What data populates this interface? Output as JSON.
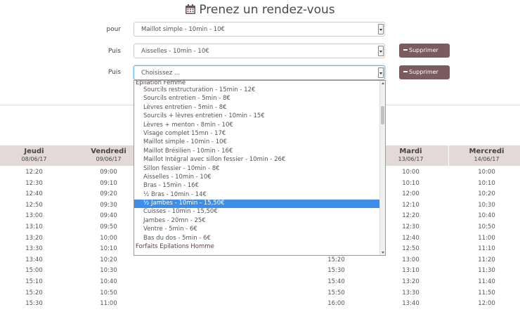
{
  "title": "Prenez un rendez-vous",
  "form": {
    "label_pour": "pour",
    "label_puis": "Puis",
    "select1_value": "Maillot simple - 10min - 10€",
    "select2_value": "Aisselles - 10min - 10€",
    "select3_value": "Choisissez ...",
    "delete_label": "Supprimer"
  },
  "dropdown": {
    "group1": "Epilation Femme",
    "options": [
      "Sourcils restructuration - 15min - 12€",
      "Sourcils entretien - 5min - 8€",
      "Lèvres entretien - 5min - 8€",
      "Sourcils + lèvres entretien - 10min - 15€",
      "Lèvres + menton - 8min - 10€",
      "Visage complet 15mn - 17€",
      "Maillot simple - 10min - 10€",
      "Maillot Brésilien - 10min - 16€",
      "Maillot Intégral avec sillon fessier - 10min - 26€",
      "Sillon fessier - 10min - 8€",
      "Aisselles - 10min - 10€",
      "Bras - 15min - 16€",
      "½ Bras - 10min - 14€",
      "½ Jambes - 10min - 15,50€",
      "Cuisses - 10min - 15,50€",
      "Jambes - 20mn - 25€",
      "Ventre - 5min - 6€",
      "Bas du dos - 5min - 6€"
    ],
    "selected_index": 13,
    "group2": "Forfaits Epilations Homme"
  },
  "calendar": {
    "days": [
      {
        "name": "Jeudi",
        "date": "08/06/17",
        "slots": [
          "12:20",
          "12:30",
          "12:40",
          "12:50",
          "13:00",
          "13:10",
          "13:20",
          "13:30",
          "13:40",
          "15:00",
          "15:10",
          "15:20",
          "15:30"
        ]
      },
      {
        "name": "Vendredi",
        "date": "09/06/17",
        "slots": [
          "09:00",
          "09:10",
          "09:20",
          "09:30",
          "09:40",
          "09:50",
          "10:00",
          "10:10",
          "10:20",
          "10:30",
          "10:40",
          "10:50",
          "11:00"
        ]
      },
      {
        "name": "",
        "date": "",
        "slots": [
          "",
          "",
          "",
          "",
          "",
          "",
          "",
          "",
          "",
          "",
          "",
          "",
          ""
        ]
      },
      {
        "name": "",
        "date": "",
        "slots": [
          "",
          "",
          "",
          "",
          "",
          "",
          "",
          "",
          "",
          "",
          "",
          "",
          ""
        ]
      },
      {
        "name": "",
        "date": "",
        "slots": [
          "",
          "",
          "",
          "",
          "",
          "",
          "",
          "",
          "15:20",
          "15:30",
          "15:40",
          "15:50",
          "16:00"
        ]
      },
      {
        "name": "Mardi",
        "date": "13/06/17",
        "slots": [
          "10:00",
          "10:10",
          "12:00",
          "12:10",
          "12:20",
          "12:30",
          "12:40",
          "12:50",
          "13:00",
          "13:10",
          "13:20",
          "13:30",
          "13:40"
        ]
      },
      {
        "name": "Mercredi",
        "date": "14/06/17",
        "slots": [
          "10:00",
          "10:10",
          "10:20",
          "10:30",
          "10:40",
          "10:50",
          "11:00",
          "11:10",
          "11:20",
          "11:30",
          "11:40",
          "11:50",
          "12:00"
        ]
      }
    ]
  },
  "colors": {
    "accent": "#7b5b5d",
    "header_bg": "#e3d9d9",
    "selected_bg": "#3d8ee8"
  }
}
